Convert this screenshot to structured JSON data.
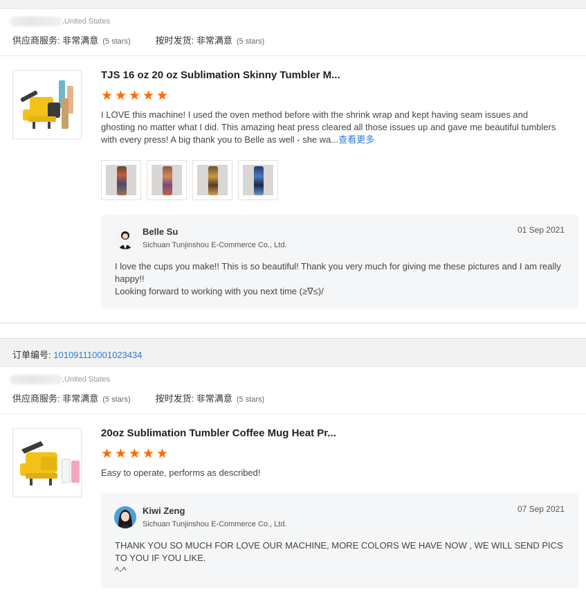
{
  "rating_labels": {
    "supplier_service": "供应商服务:",
    "ontime_delivery": "按时发货:",
    "value": "非常满意",
    "stars": "(5 stars)"
  },
  "reviews": [
    {
      "buyer_country": ",United States",
      "product_title": "TJS 16 oz 20 oz Sublimation Skinny Tumbler M...",
      "star_count": 5,
      "text": "I LOVE this machine!  I used the oven method before with the shrink wrap and kept having seam issues and ghosting no matter what I did.  This amazing heat press cleared all those issues up and gave me beautiful tumblers with every press!  A big thank you to Belle as well - she wa...",
      "more_label": "查看更多",
      "photo_count": 4,
      "reply": {
        "name": "Belle Su",
        "company": "Sichuan Tunjinshou E-Commerce Co., Ltd.",
        "date": "01 Sep 2021",
        "text": " I love the cups you make!! This is so beautiful! Thank you very much for giving me these pictures and I am really happy!!\nLooking forward to working with you next time (≥∇≤)/"
      }
    },
    {
      "order_label": "订单编号:",
      "order_number": "101091110001023434",
      "buyer_country": ",United States",
      "product_title": "20oz Sublimation Tumbler Coffee Mug Heat Pr...",
      "star_count": 5,
      "text": "Easy to operate, performs as described!",
      "reply": {
        "name": "Kiwi Zeng",
        "company": "Sichuan Tunjinshou E-Commerce Co., Ltd.",
        "date": "07 Sep 2021",
        "text": "THANK YOU SO MUCH FOR LOVE OUR MACHINE, MORE COLORS WE HAVE NOW , WE WILL SEND PICS TO YOU IF YOU LIKE.\n^-^"
      }
    }
  ],
  "colors": {
    "star": "#ff6a00",
    "link": "#2b7bd3",
    "press_yellow": "#f2c21b"
  },
  "icons": {
    "star": "star-icon",
    "avatar_1": "avatar-belle-su",
    "avatar_2": "avatar-kiwi-zeng"
  }
}
